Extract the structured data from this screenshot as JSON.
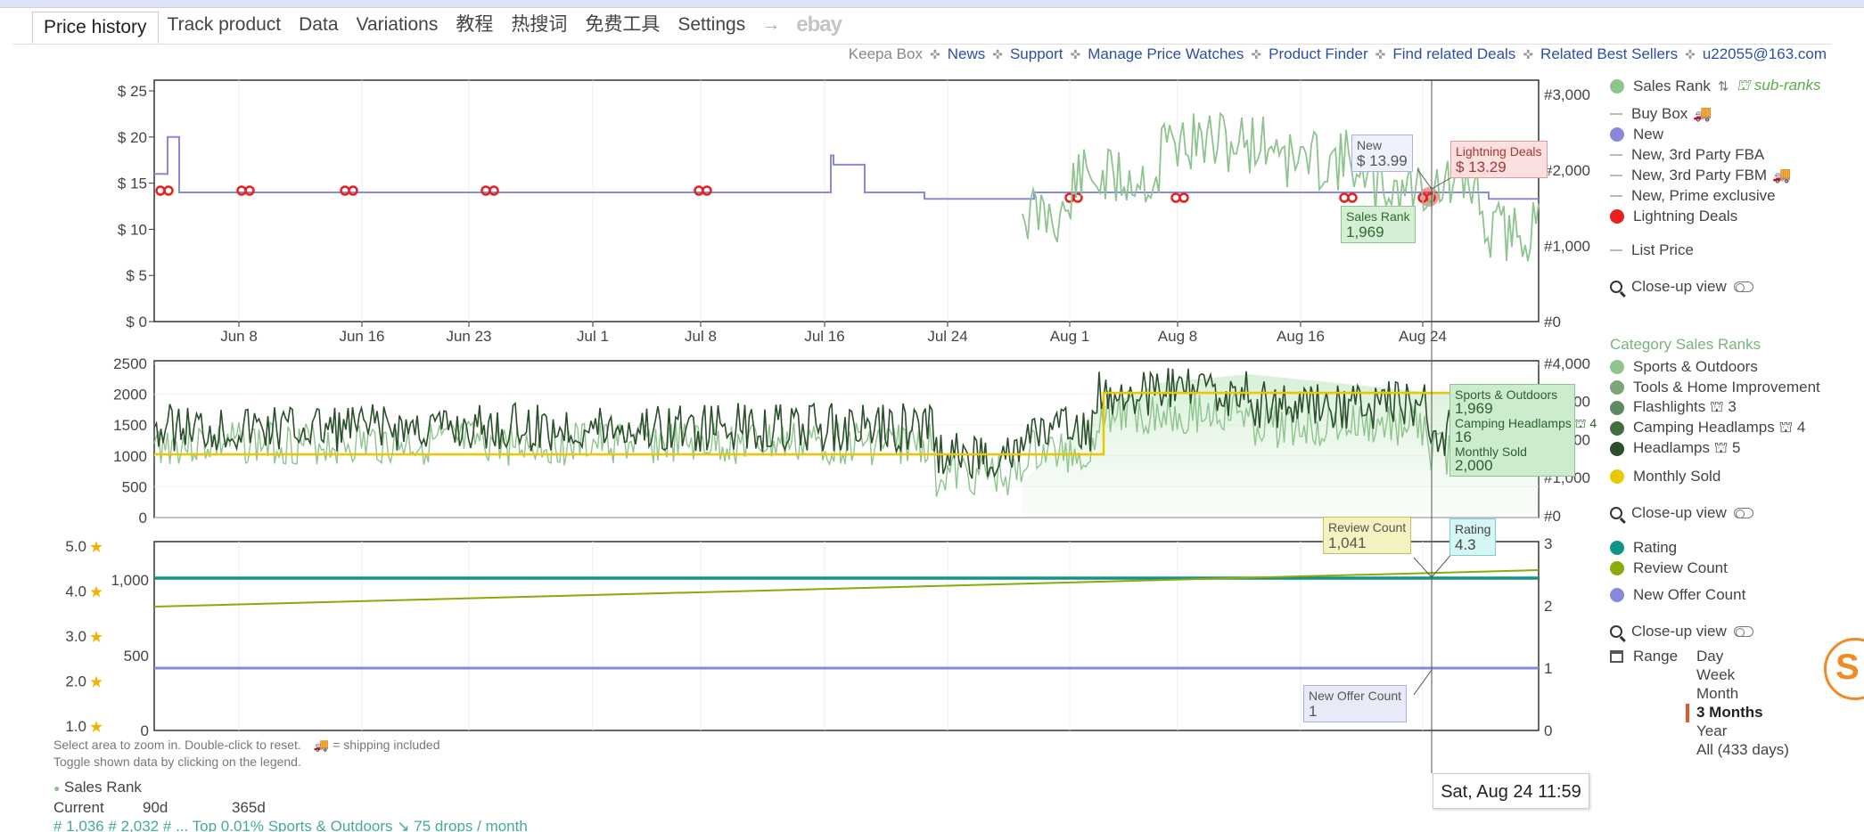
{
  "tabs": {
    "price_history": "Price history",
    "track_product": "Track product",
    "data": "Data",
    "variations": "Variations",
    "tutorial": "教程",
    "hot_search": "热搜词",
    "free_tools": "免费工具",
    "settings": "Settings",
    "arrow": "→",
    "ebay": "ebay"
  },
  "toplinks": {
    "keepa_box": "Keepa Box",
    "news": "News",
    "support": "Support",
    "manage_watches": "Manage Price Watches",
    "product_finder": "Product Finder",
    "related_deals": "Find related Deals",
    "related_best": "Related Best Sellers",
    "user": "u22055@163.com",
    "sep": "✜"
  },
  "colors": {
    "sales_rank": "#8ec48e",
    "new": "#8888dd",
    "lightning": "#e8211e",
    "yellow": "#e8c800",
    "rating": "#119488",
    "review": "#8aab0a",
    "offer": "#8888dd"
  },
  "chart_data": [
    {
      "type": "line",
      "y_ticks": [
        "$ 25",
        "$ 20",
        "$ 15",
        "$ 10",
        "$ 5",
        "$ 0"
      ],
      "y2_ticks": [
        "#3,000",
        "#2,000",
        "#1,000",
        "#0"
      ],
      "x_ticks": [
        "Jun 8",
        "Jun 16",
        "Jun 23",
        "Jul 1",
        "Jul 8",
        "Jul 16",
        "Jul 24",
        "Aug 1",
        "Aug 8",
        "Aug 16",
        "Aug 24"
      ],
      "ylim": [
        0,
        25
      ],
      "y2lim": [
        0,
        3500
      ],
      "series": [
        {
          "name": "New",
          "points": [
            [
              0,
              16
            ],
            [
              0.035,
              16
            ],
            [
              0.035,
              20
            ],
            [
              0.055,
              20
            ],
            [
              0.055,
              14
            ],
            [
              0.49,
              14
            ],
            [
              0.49,
              14.1
            ],
            [
              0.49,
              14.05
            ],
            [
              0.49,
              14
            ],
            [
              0.49,
              14
            ],
            [
              0.49,
              14
            ],
            [
              0.49,
              14
            ],
            [
              0.49,
              14
            ],
            [
              0.49,
              14
            ],
            [
              0.49,
              14
            ],
            [
              0.49,
              14
            ],
            [
              0.49,
              14
            ],
            [
              0.49,
              14
            ],
            [
              0.49,
              14
            ],
            [
              0.49,
              14
            ],
            [
              0.49,
              14
            ],
            [
              0.49,
              14
            ],
            [
              0.49,
              14
            ],
            [
              0.49,
              14
            ],
            [
              0.49,
              14
            ],
            [
              0.49,
              14
            ],
            [
              0.49,
              14
            ],
            [
              0.49,
              14
            ],
            [
              0.49,
              14
            ],
            [
              0.49,
              14
            ]
          ]
        }
      ],
      "new_tooltip": {
        "label": "New",
        "value": "$ 13.99"
      },
      "lightning_tooltip": {
        "label": "Lightning Deals",
        "value": "$ 13.29"
      },
      "salesrank_tooltip": {
        "label": "Sales Rank",
        "value": "1,969"
      }
    },
    {
      "type": "line",
      "y_ticks": [
        "2500",
        "2000",
        "1500",
        "1000",
        "500",
        "0"
      ],
      "y2_ticks": [
        "#4,000",
        "#3,000",
        "#2,000",
        "#1,000",
        "#0"
      ],
      "ylim": [
        0,
        2500
      ],
      "tooltip": {
        "sports": "Sports & Outdoors",
        "sports_val": "1,969",
        "camping": "Camping Headlamps ⛫ 4",
        "camping_val": "16",
        "monthly": "Monthly Sold",
        "monthly_val": "2,000"
      }
    },
    {
      "type": "line",
      "y_ticks": [
        "5.0",
        "4.0",
        "3.0",
        "2.0",
        "1.0"
      ],
      "y_mid_ticks": [
        "1,000",
        "500",
        "0"
      ],
      "y2_ticks": [
        "3",
        "2",
        "1",
        "0"
      ],
      "review_tooltip": {
        "label": "Review Count",
        "value": "1,041"
      },
      "rating_tooltip": {
        "label": "Rating",
        "value": "4.3"
      },
      "offer_tooltip": {
        "label": "New Offer Count",
        "value": "1"
      }
    }
  ],
  "legend": {
    "sales_rank": "Sales Rank",
    "sub_ranks": "sub-ranks",
    "buy_box": "Buy Box",
    "new": "New",
    "new_fba": "New, 3rd Party FBA",
    "new_fbm": "New, 3rd Party FBM",
    "new_prime": "New, Prime exclusive",
    "lightning": "Lightning Deals",
    "list_price": "List Price",
    "closeup": "Close-up view",
    "category_ranks": "Category Sales Ranks",
    "sports": "Sports & Outdoors",
    "tools": "Tools & Home Improvement",
    "flashlights": "Flashlights ⛫ 3",
    "camping": "Camping Headlamps ⛫ 4",
    "headlamps": "Headlamps ⛫ 5",
    "monthly_sold": "Monthly Sold",
    "rating": "Rating",
    "review_count": "Review Count",
    "new_offer": "New Offer Count",
    "range": "Range"
  },
  "range_options": [
    "Day",
    "Week",
    "Month",
    "3 Months",
    "Year",
    "All (433 days)"
  ],
  "footer": {
    "zoom_hint": "Select area to zoom in. Double-click to reset.",
    "shipping_hint": "= shipping included",
    "toggle_hint": "Toggle shown data by clicking on the legend.",
    "sr_title": "Sales Rank",
    "current": "Current",
    "d90": "90d",
    "d365": "365d",
    "row": "#  1,036      #  2,032      #  ...     Top 0.01%   Sports & Outdoors   ↘ 75 drops / month"
  },
  "datebox": "Sat, Aug 24 11:59"
}
